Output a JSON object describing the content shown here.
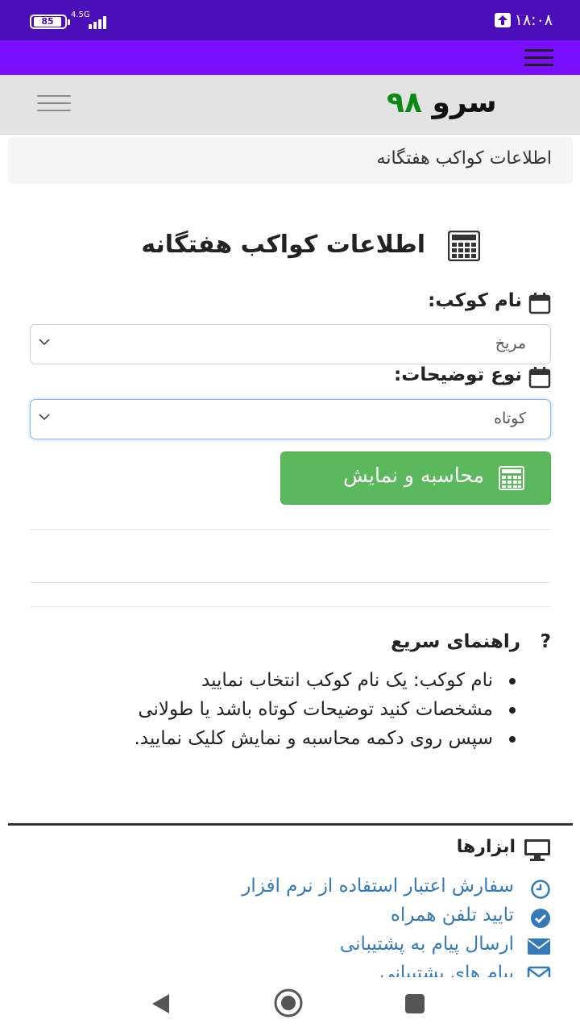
{
  "status_bar": {
    "time": "۱۸:۰۸",
    "battery": "85",
    "network": "4.5G"
  },
  "header": {
    "logo_text": "سرو",
    "logo_number": "۹۸"
  },
  "breadcrumb": {
    "text": "اطلاعات کواکب هفتگانه"
  },
  "main": {
    "title": "اطلاعات کواکب هفتگانه",
    "planet_label": "نام کوکب:",
    "planet_value": "مریخ",
    "desc_label": "نوع توضیحات:",
    "desc_value": "کوتاه",
    "calc_button": "محاسبه و نمایش"
  },
  "guide": {
    "title": "راهنمای سریع",
    "q_mark": "?",
    "items": [
      "نام کوکب: یک نام کوکب انتخاب نمایید",
      "مشخصات کنید توضیحات کوتاه باشد یا طولانی",
      "سپس روی دکمه محاسبه و نمایش کلیک نمایید."
    ]
  },
  "tools": {
    "title": "ابزارها",
    "links": [
      "سفارش اعتبار استفاده از نرم افزار",
      "تایید تلفن همراه",
      "ارسال پیام به پشتیبانی",
      "پیام های پشتیبانی"
    ]
  },
  "colors": {
    "status_bar": "#4a0fb8",
    "app_bar": "#7a0fff",
    "logo_number": "#0a8a12",
    "button": "#5cb85c",
    "link": "#337ab7"
  }
}
